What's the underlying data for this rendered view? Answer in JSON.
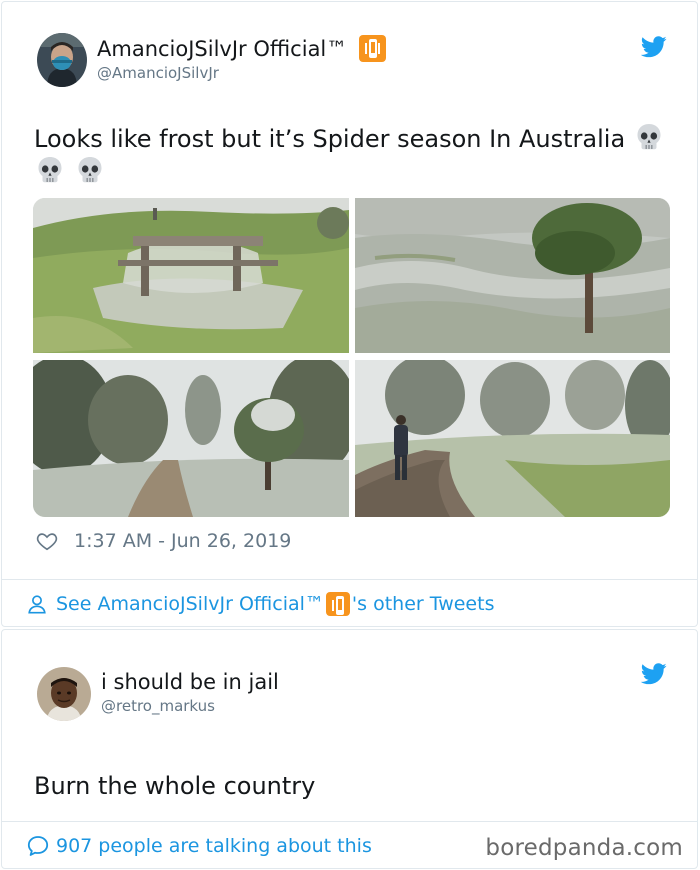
{
  "tweet1": {
    "display_name": "AmancioJSilvJr Official™",
    "handle": "@AmancioJSilvJr",
    "text": "Looks like frost but it’s Spider season In Australia",
    "timestamp": "1:37 AM - Jun 26, 2019",
    "see_others_prefix": "See AmancioJSilvJr Official™",
    "see_others_suffix": "'s other Tweets",
    "icons": [
      "vibration-mode-emoji",
      "skull-emoji",
      "twitter-bird-icon",
      "heart-icon",
      "person-icon"
    ]
  },
  "tweet2": {
    "display_name": "i should be in jail",
    "handle": "@retro_markus",
    "text": "Burn the whole country",
    "talking": "907 people are talking about this",
    "icons": [
      "twitter-bird-icon",
      "comment-bubble-icon"
    ]
  },
  "watermark": "boredpanda.com",
  "colors": {
    "link": "#1b95e0",
    "muted": "#657786",
    "text": "#14171a",
    "border": "#e1e8ed",
    "twitter_blue": "#1da1f2"
  }
}
